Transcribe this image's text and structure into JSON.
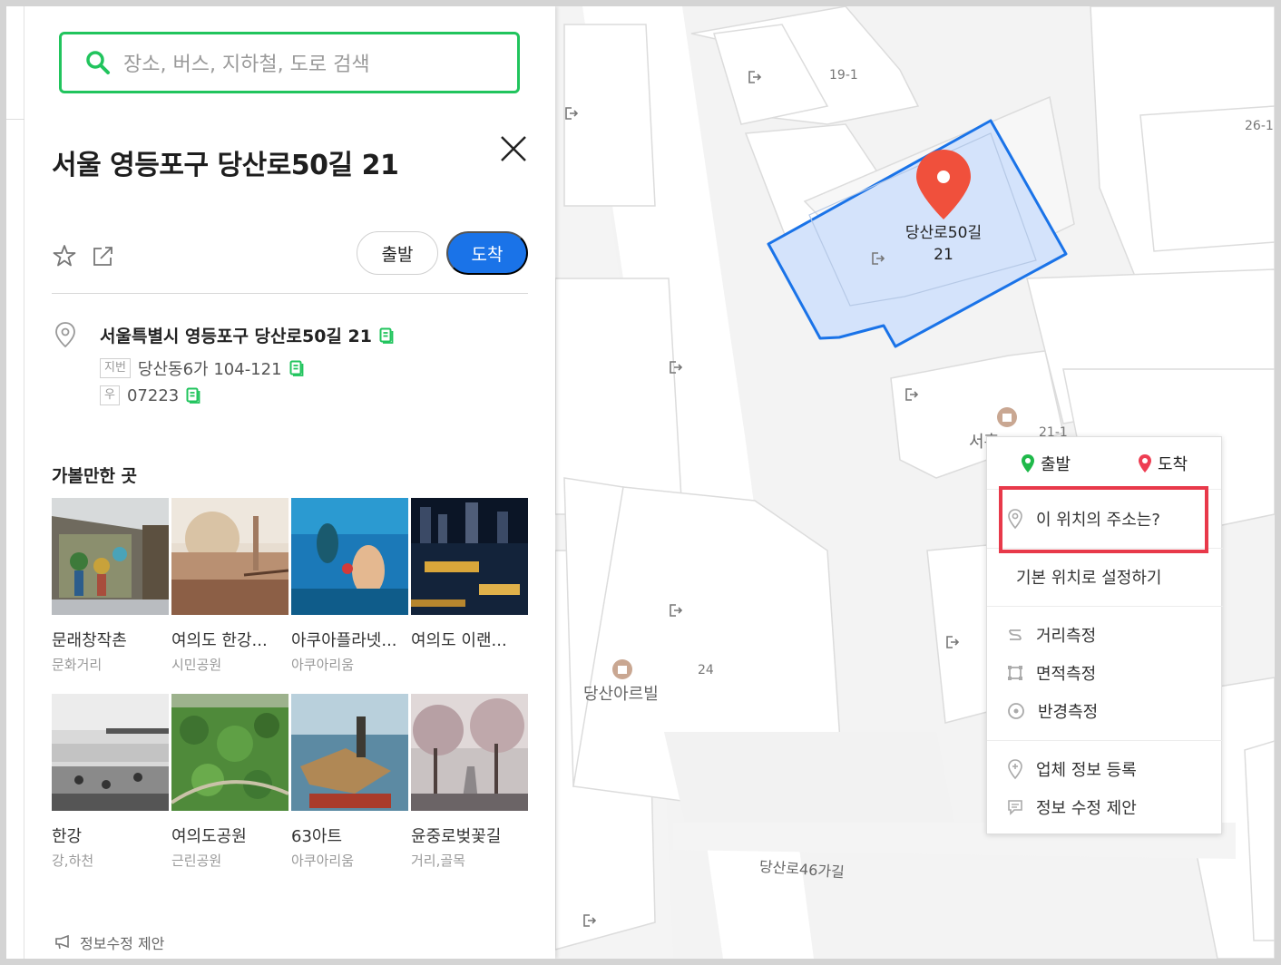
{
  "search": {
    "placeholder": "장소, 버스, 지하철, 도로 검색"
  },
  "place": {
    "title": "서울 영등포구 당산로50길 21",
    "address_road": "서울특별시 영등포구 당산로50길 21",
    "jibun_tag": "지번",
    "address_jibun": "당산동6가 104-121",
    "postal_tag": "우",
    "postal_code": "07223"
  },
  "actions": {
    "depart": "출발",
    "arrive": "도착"
  },
  "recommend": {
    "title": "가볼만한 곳",
    "items": [
      {
        "name": "문래창작촌",
        "category": "문화거리"
      },
      {
        "name": "여의도 한강...",
        "category": "시민공원"
      },
      {
        "name": "아쿠아플라넷...",
        "category": "아쿠아리움"
      },
      {
        "name": "여의도 이랜...",
        "category": ""
      },
      {
        "name": "한강",
        "category": "강,하천"
      },
      {
        "name": "여의도공원",
        "category": "근린공원"
      },
      {
        "name": "63아트",
        "category": "아쿠아리움"
      },
      {
        "name": "윤중로벚꽃길",
        "category": "거리,골목"
      }
    ]
  },
  "report_label": "정보수정 제안",
  "map": {
    "selected_label_line1": "당산로50길",
    "selected_label_line2": "21",
    "labels": {
      "l19_1": "19-1",
      "l26": "26-1",
      "l24": "24",
      "l21_1": "21-1",
      "dangsan_arlbil": "당산아르빌",
      "road_46": "당산로46가길",
      "poi_partial": "서흥"
    },
    "accent": "#1a73e8",
    "selection_fill": "#d4e3fb",
    "marker_color": "#f0503c"
  },
  "context_menu": {
    "depart": "출발",
    "arrive": "도착",
    "address_query": "이 위치의 주소는?",
    "set_default": "기본 위치로 설정하기",
    "measure_distance": "거리측정",
    "measure_area": "면적측정",
    "measure_radius": "반경측정",
    "register_business": "업체 정보 등록",
    "suggest_edit": "정보 수정 제안"
  }
}
